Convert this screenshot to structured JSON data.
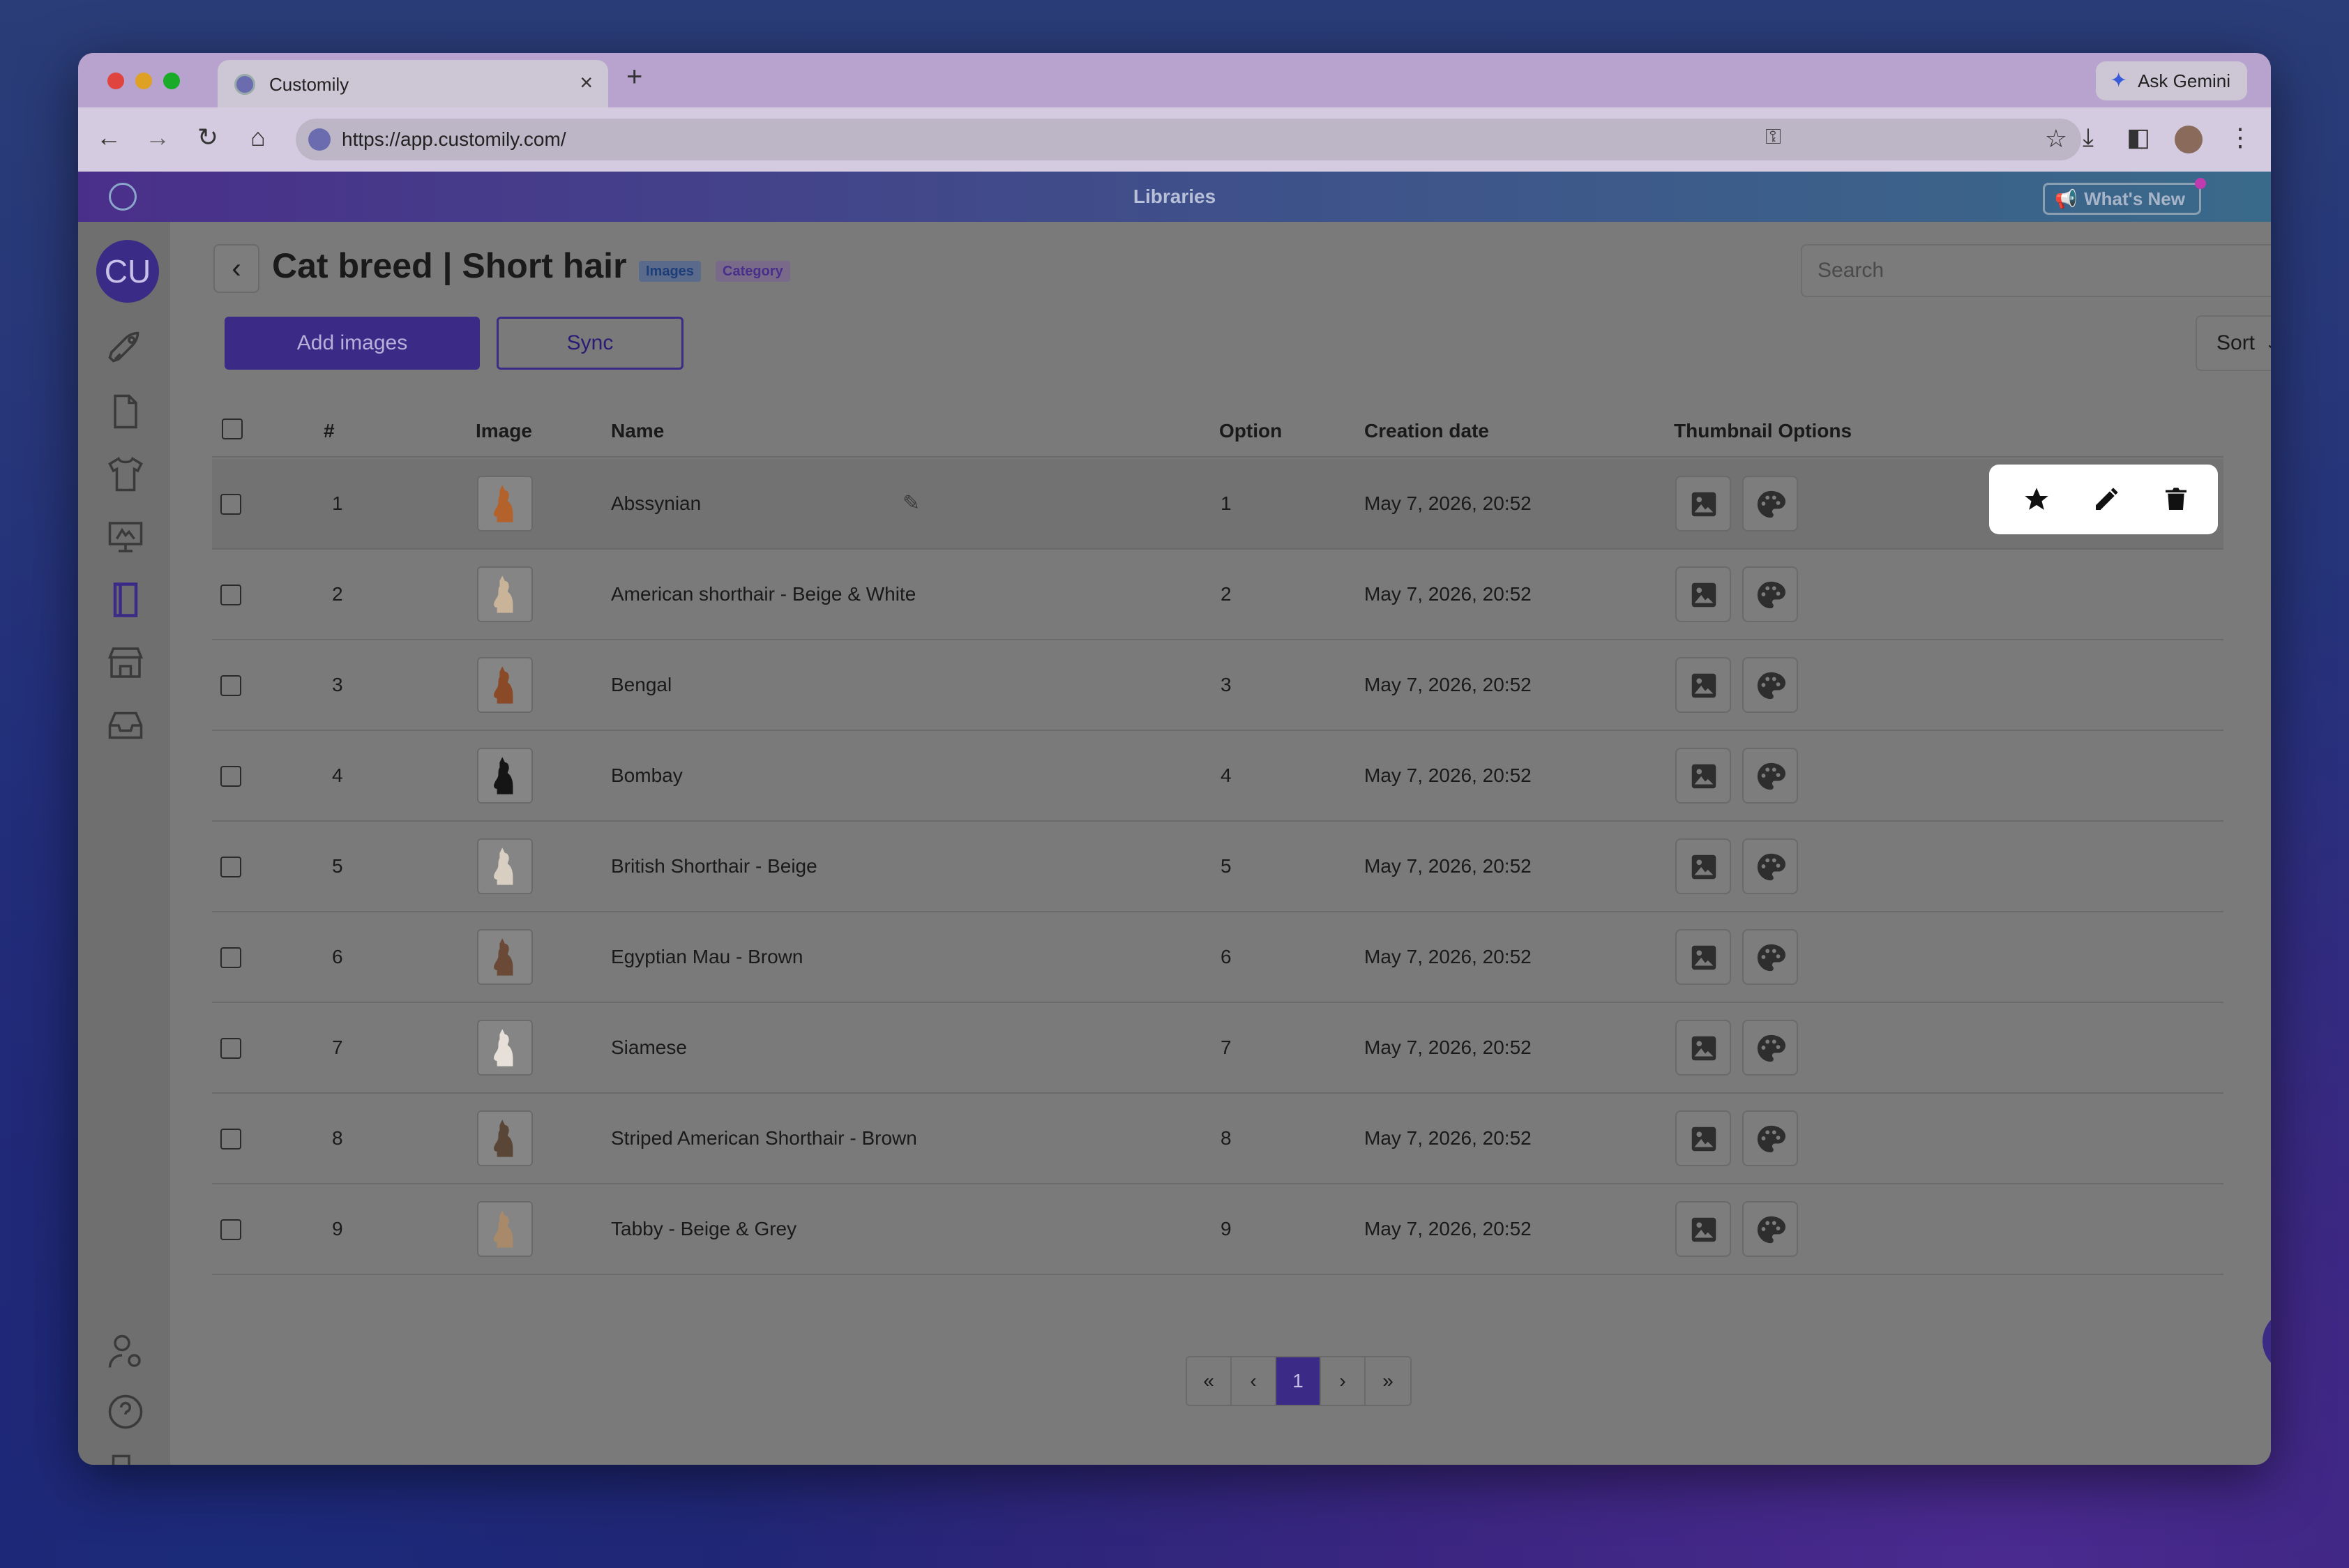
{
  "browser": {
    "tab_title": "Customily",
    "tab_close": "×",
    "new_tab": "+",
    "gemini_label": "Ask Gemini",
    "url": "https://app.customily.com/"
  },
  "header": {
    "section_title": "Libraries",
    "whats_new": "What's New"
  },
  "user": {
    "initials": "CU"
  },
  "page": {
    "title": "Cat breed | Short hair",
    "badge_images": "Images",
    "badge_category": "Category",
    "search_placeholder": "Search",
    "add_images_label": "Add images",
    "sync_label": "Sync",
    "sort_label": "Sort"
  },
  "table": {
    "columns": {
      "index": "#",
      "image": "Image",
      "name": "Name",
      "option": "Option",
      "created": "Creation date",
      "thumbnail": "Thumbnail Options"
    },
    "rows": [
      {
        "index": "1",
        "name": "Abssynian",
        "option": "1",
        "created": "May 7, 2026, 20:52",
        "cat_color": "#b4622c"
      },
      {
        "index": "2",
        "name": "American shorthair - Beige & White",
        "option": "2",
        "created": "May 7, 2026, 20:52",
        "cat_color": "#c9b49a"
      },
      {
        "index": "3",
        "name": "Bengal",
        "option": "3",
        "created": "May 7, 2026, 20:52",
        "cat_color": "#8a4a28"
      },
      {
        "index": "4",
        "name": "Bombay",
        "option": "4",
        "created": "May 7, 2026, 20:52",
        "cat_color": "#151515"
      },
      {
        "index": "5",
        "name": "British Shorthair - Beige",
        "option": "5",
        "created": "May 7, 2026, 20:52",
        "cat_color": "#d8cfc2"
      },
      {
        "index": "6",
        "name": "Egyptian Mau - Brown",
        "option": "6",
        "created": "May 7, 2026, 20:52",
        "cat_color": "#6a4a36"
      },
      {
        "index": "7",
        "name": "Siamese",
        "option": "7",
        "created": "May 7, 2026, 20:52",
        "cat_color": "#e6e0d8"
      },
      {
        "index": "8",
        "name": "Striped American Shorthair - Brown",
        "option": "8",
        "created": "May 7, 2026, 20:52",
        "cat_color": "#5a4636"
      },
      {
        "index": "9",
        "name": "Tabby - Beige & Grey",
        "option": "9",
        "created": "May 7, 2026, 20:52",
        "cat_color": "#a88a6a"
      }
    ]
  },
  "pagination": {
    "first": "«",
    "prev": "‹",
    "current": "1",
    "next": "›",
    "last": "»"
  },
  "colors": {
    "brand": "#3b2a86",
    "overlay_bg": "#7a7a7a"
  }
}
